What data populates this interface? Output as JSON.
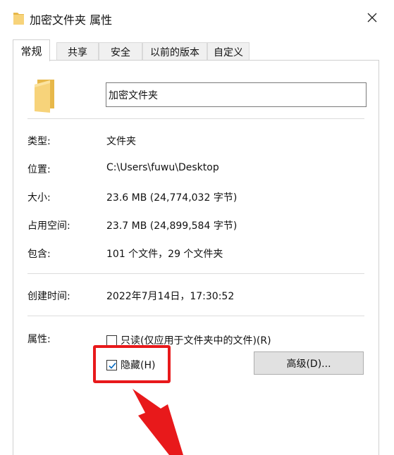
{
  "window": {
    "title": "加密文件夹 属性",
    "title_icon": "folder-icon",
    "close_icon": "close-icon"
  },
  "tabs": [
    {
      "label": "常规",
      "active": true
    },
    {
      "label": "共享",
      "active": false
    },
    {
      "label": "安全",
      "active": false
    },
    {
      "label": "以前的版本",
      "active": false
    },
    {
      "label": "自定义",
      "active": false
    }
  ],
  "general": {
    "folder_name": "加密文件夹",
    "props": [
      {
        "label": "类型:",
        "value": "文件夹"
      },
      {
        "label": "位置:",
        "value": "C:\\Users\\fuwu\\Desktop"
      },
      {
        "label": "大小:",
        "value": "23.6 MB (24,774,032 字节)"
      },
      {
        "label": "占用空间:",
        "value": "23.7 MB (24,899,584 字节)"
      },
      {
        "label": "包含:",
        "value": "101 个文件，29 个文件夹"
      }
    ],
    "created": {
      "label": "创建时间:",
      "value": "2022年7月14日，17:30:52"
    },
    "attributes": {
      "label": "属性:",
      "readonly": {
        "label": "只读(仅应用于文件夹中的文件)(R)",
        "checked": false
      },
      "hidden": {
        "label": "隐藏(H)",
        "checked": true
      },
      "advanced_label": "高级(D)..."
    }
  },
  "colors": {
    "highlight": "#e8191b",
    "folder": "#f7d37a",
    "checkbox_accent": "#0067c0"
  }
}
